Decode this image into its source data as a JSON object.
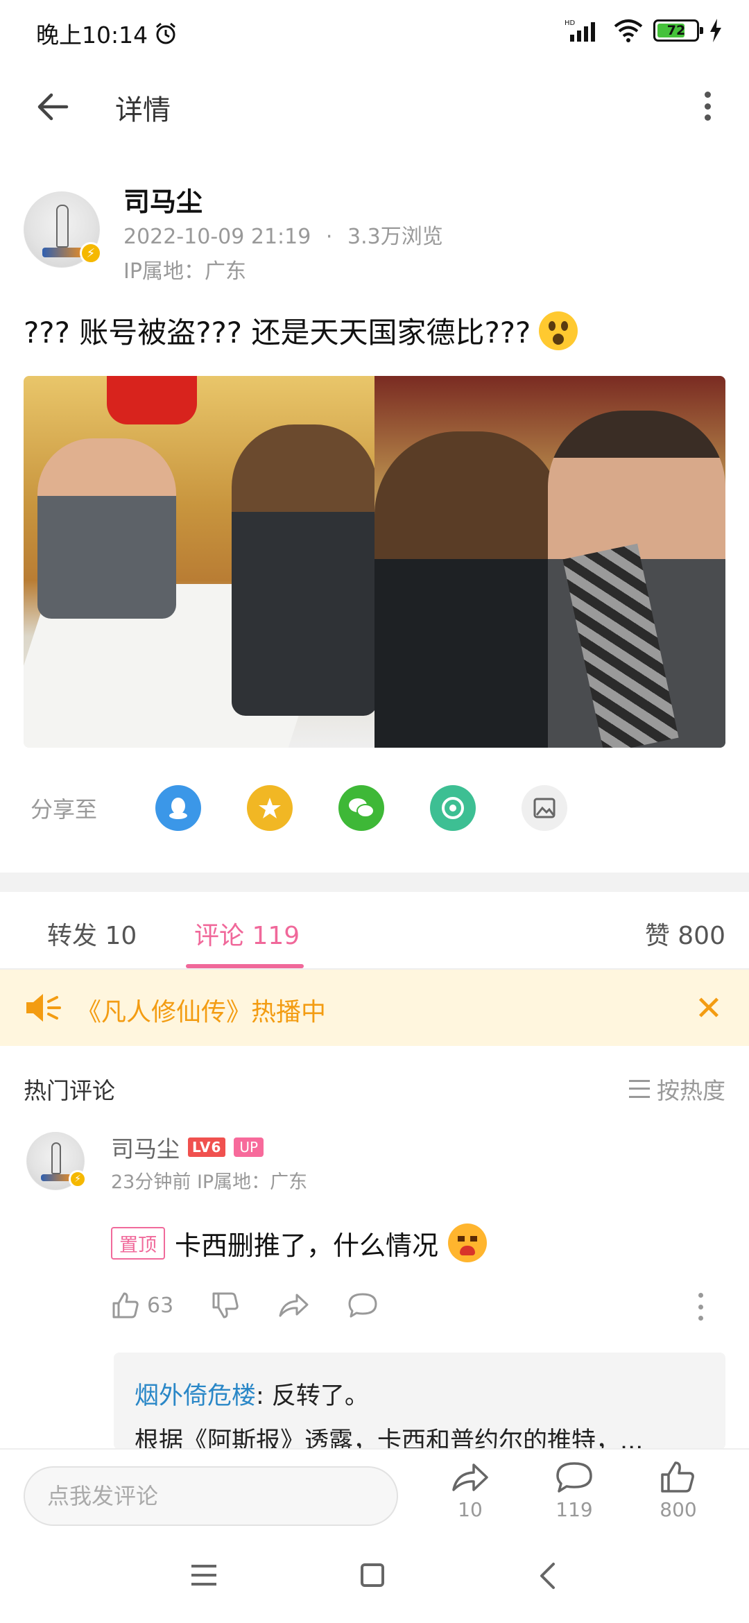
{
  "status_bar": {
    "time": "晚上10:14",
    "battery_level": 72,
    "battery_text": "72",
    "network": "HD"
  },
  "app_bar": {
    "title": "详情"
  },
  "post": {
    "author": "司马尘",
    "time": "2022-10-09 21:19",
    "separator": "·",
    "views": "3.3万浏览",
    "ip": "IP属地：广东",
    "text": "??? 账号被盗??? 还是天天国家德比???"
  },
  "share": {
    "label": "分享至",
    "targets": [
      "qq-icon",
      "qzone-icon",
      "wechat-icon",
      "moments-icon",
      "poster-icon"
    ]
  },
  "tabs": {
    "repost": "转发 10",
    "comment": "评论 119",
    "like": "赞 800",
    "active_color": "#f0689a"
  },
  "notice": {
    "text": "《凡人修仙传》热播中",
    "color": "#f39c12"
  },
  "comments_section": {
    "title": "热门评论",
    "sort": "按热度"
  },
  "comment": {
    "user": "司马尘",
    "level": "LV6",
    "up_badge": "UP",
    "meta": "23分钟前  IP属地：广东",
    "pin": "置顶",
    "text": "卡西删推了，什么情况",
    "likes": "63"
  },
  "reply": {
    "user": "烟外倚危楼",
    "text": ": 反转了。",
    "line2": "根据《阿斯报》透露，卡西和普约尔的推特，..."
  },
  "bottom_bar": {
    "placeholder": "点我发评论",
    "share_count": "10",
    "comment_count": "119",
    "like_count": "800"
  }
}
